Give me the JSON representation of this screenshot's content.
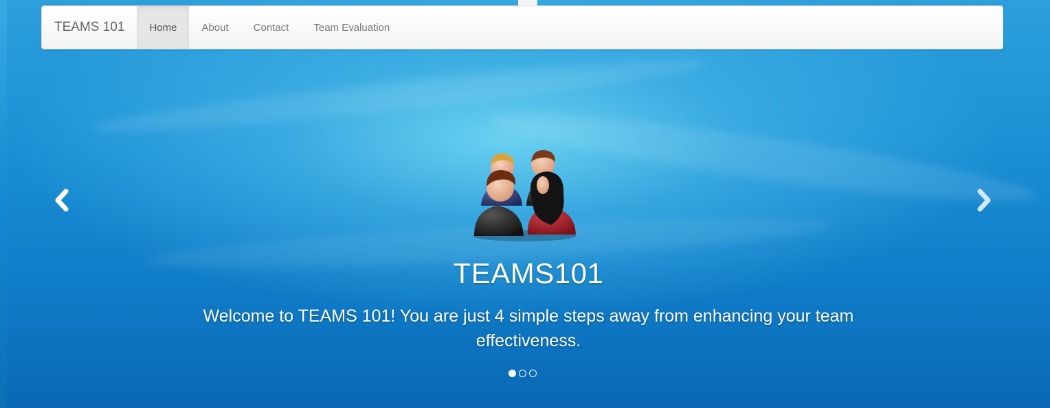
{
  "navbar": {
    "brand": "TEAMS 101",
    "items": [
      {
        "label": "Home",
        "active": true
      },
      {
        "label": "About",
        "active": false
      },
      {
        "label": "Contact",
        "active": false
      },
      {
        "label": "Team Evaluation",
        "active": false
      }
    ]
  },
  "hero": {
    "icon": "team-people-icon",
    "title": "TEAMS101",
    "caption": "Welcome to TEAMS 101! You are just 4 simple steps away from enhancing your team effectiveness."
  },
  "carousel": {
    "prev_icon": "chevron-left-icon",
    "next_icon": "chevron-right-icon",
    "slide_count": 3,
    "active_index": 0
  },
  "colors": {
    "background_blue": "#1b90d5",
    "navbar_bg": "#f7f7f7",
    "active_nav_bg": "#e6e6e6",
    "text_white": "#ffffff"
  }
}
